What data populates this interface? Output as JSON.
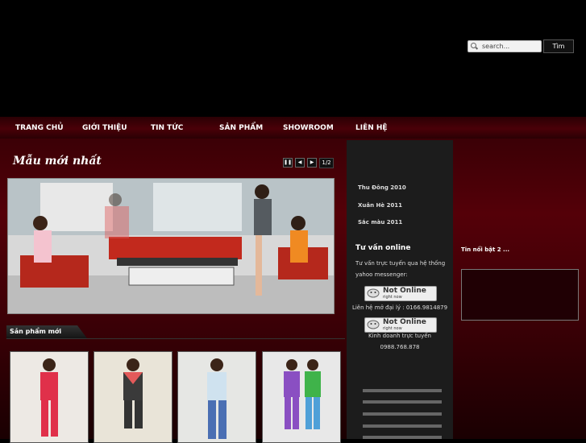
{
  "search": {
    "placeholder": "search...",
    "button": "Tìm"
  },
  "nav": [
    "TRANG CHỦ",
    "GIỚI THIỆU",
    "TIN TỨC",
    "SẢN PHẨM",
    "SHOWROOM",
    "LIÊN HỆ"
  ],
  "slider": {
    "title": "Mẫu mới nhất",
    "page": "1/2"
  },
  "new_products": {
    "tab": "Sản phẩm mới",
    "count": 4
  },
  "sidebar": {
    "links": [
      "Thu Đông 2010",
      "Xuân Hè 2011",
      "Sắc màu 2011"
    ],
    "consult_title": "Tư vấn online",
    "consult_text": [
      "Tư vấn trực tuyến qua hệ thống",
      "yahoo messenger:"
    ],
    "agents": [
      {
        "status": "Not Online",
        "sub": "right now",
        "label": "Liên hệ mở đại lý : 0166.9814879"
      },
      {
        "status": "Not Online",
        "sub": "right now",
        "label": "Kinh doanh trực tuyến",
        "phone": "0988.768.878"
      }
    ]
  },
  "right": {
    "title": "Tin nổi bật 2 ..."
  }
}
